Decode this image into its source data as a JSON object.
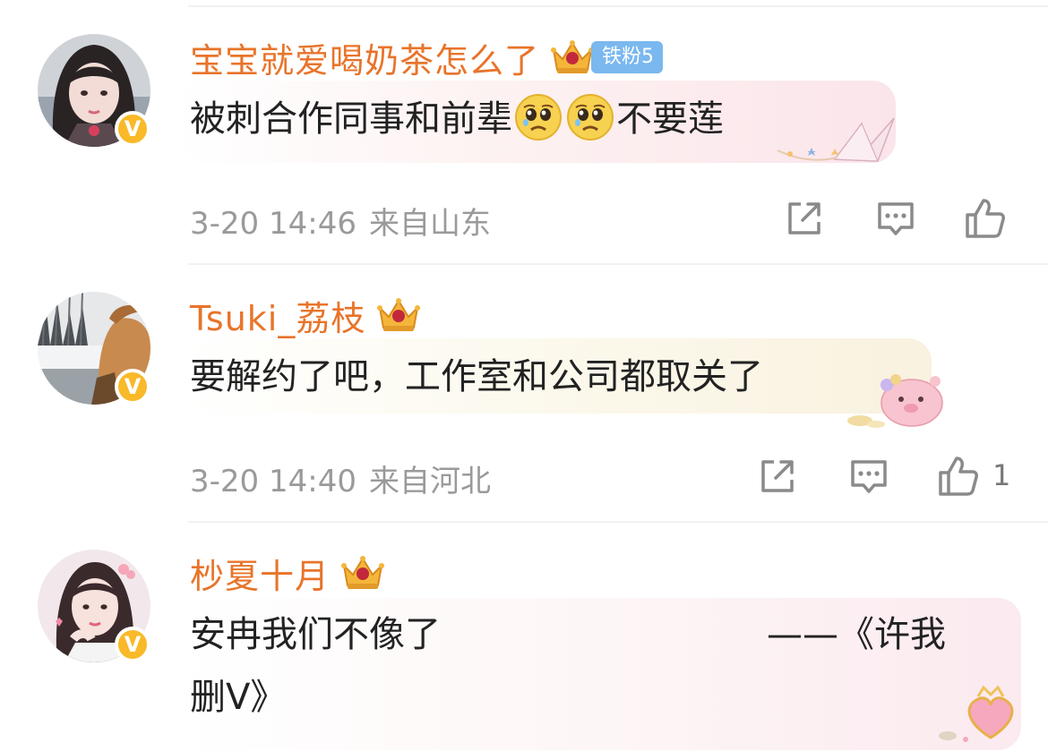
{
  "comments": [
    {
      "username": "宝宝就爱喝奶茶怎么了",
      "fan_badge": "铁粉5",
      "text": "被刺合作同事和前辈",
      "text_after": "不要莲",
      "date": "3-20 14:46",
      "location": "来自山东",
      "likes": ""
    },
    {
      "username": "Tsuki_荔枝",
      "text": "要解约了吧，工作室和公司都取关了",
      "date": "3-20 14:40",
      "location": "来自河北",
      "likes": "1"
    },
    {
      "username": "杪夏十月",
      "text_line1": "安冉我们不像了",
      "text_line1_right": "——《许我",
      "text_line2": "删V》"
    }
  ],
  "icons": {
    "verified_badge": "V",
    "repost": "repost-icon",
    "comment": "comment-icon",
    "like": "thumbs-up-icon",
    "crown": "crown-icon",
    "emoji": "crying-face-emoji"
  },
  "colors": {
    "username": "#e8742a",
    "fan_badge": "#7ab8ef",
    "verified": "#f9b928",
    "meta": "#9a9a9a"
  }
}
